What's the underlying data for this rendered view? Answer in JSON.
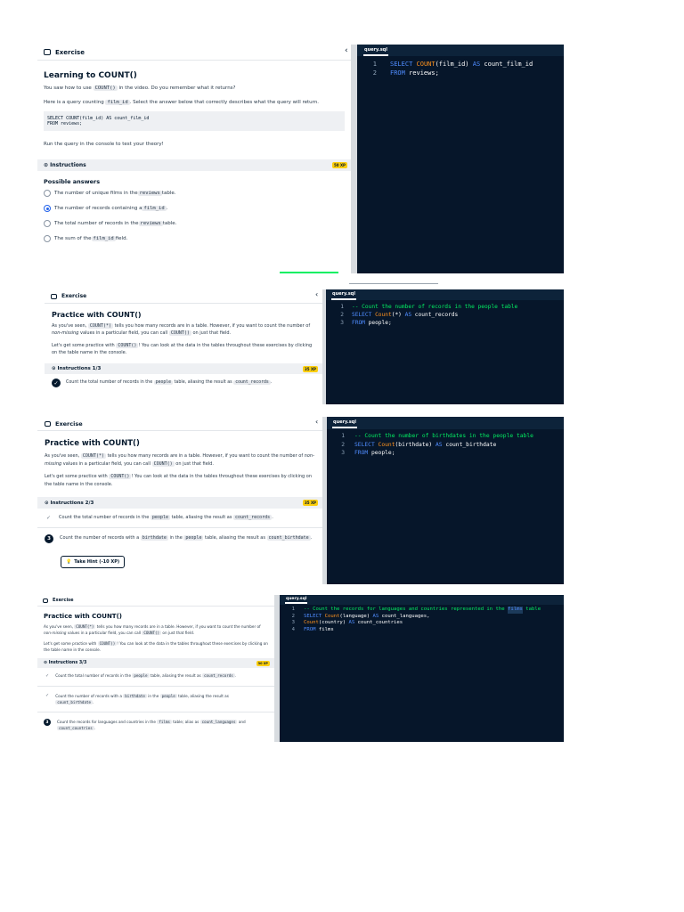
{
  "screens": {
    "s1": {
      "section_label": "Exercise",
      "title": "Learning to COUNT()",
      "p1_a": "You saw how to use ",
      "p1_code": "COUNT()",
      "p1_b": " in the video. Do you remember what it returns?",
      "p2_a": "Here is a query counting ",
      "p2_code": "film_id",
      "p2_b": ". Select the answer below that correctly describes what the query will return.",
      "code_lines": [
        "SELECT COUNT(film_id) AS count_film_id",
        "FROM reviews;"
      ],
      "p3": "Run the query in the console to test your theory!",
      "instructions_label": "Instructions",
      "xp": "50 XP",
      "possible_answers_label": "Possible answers",
      "answers": [
        {
          "a": "The number of unique films in the ",
          "code": "reviews",
          "b": " table."
        },
        {
          "a": "The number of records containing a ",
          "code": "film_id",
          "b": "."
        },
        {
          "a": "The total number of records in the ",
          "code": "reviews",
          "b": " table."
        },
        {
          "a": "The sum of the ",
          "code": "film_id",
          "b": " field."
        }
      ],
      "tab": "query.sql",
      "editor": [
        {
          "n": "1",
          "t1": "SELECT ",
          "f": "COUNT",
          "t2": "(film_id) ",
          "k2": "AS",
          "t3": " count_film_id"
        },
        {
          "n": "2",
          "t1": "FROM",
          "f": "",
          "t2": " reviews;",
          "k2": "",
          "t3": ""
        }
      ]
    },
    "s2": {
      "section_label": "Exercise",
      "title": "Practice with COUNT()",
      "p1_a": "As you've seen, ",
      "p1_code": "COUNT(*)",
      "p1_b": " tells you how many records are in a table. However, if you want to count the number of ",
      "p1_em": "non-missing",
      "p1_c": " values in a particular field, you can call ",
      "p1_code2": "COUNT()",
      "p1_d": " on just that field.",
      "p2_a": "Let's get some practice with ",
      "p2_code": "COUNT()",
      "p2_b": "! You can look at the data in the tables throughout these exercises by clicking on the table name in the console.",
      "instructions_label": "Instructions 1/3",
      "xp": "35 XP",
      "step1_a": "Count the total number of records in the ",
      "step1_code": "people",
      "step1_b": " table, aliasing the result as ",
      "step1_code2": "count_records",
      "step1_c": ".",
      "tab": "query.sql",
      "editor": [
        {
          "n": "1",
          "c": "-- Count the number of records in the people table"
        },
        {
          "n": "2",
          "k1": "SELECT ",
          "f": "Count",
          "t": "(*) ",
          "k2": "AS",
          "t2": " count_records"
        },
        {
          "n": "3",
          "k1": "FROM",
          "t": " people;"
        }
      ]
    },
    "s3": {
      "section_label": "Exercise",
      "title": "Practice with COUNT()",
      "p1_a": "As you've seen, ",
      "p1_code": "COUNT(*)",
      "p1_b": " tells you how many records are in a table. However, if you want to count the number of ",
      "p1_em": "non-missing",
      "p1_c": " values in a particular field, you can call ",
      "p1_code2": "COUNT()",
      "p1_d": " on just that field.",
      "p2_a": "Let's get some practice with ",
      "p2_code": "COUNT()",
      "p2_b": "! You can look at the data in the tables throughout these exercises by clicking on the table name in the console.",
      "instructions_label": "Instructions 2/3",
      "xp": "35 XP",
      "step1_a": "Count the total number of records in the ",
      "step1_code": "people",
      "step1_b": " table, aliasing the result as ",
      "step1_code2": "count_records",
      "step1_c": ".",
      "step2_a": "Count the number of records with a ",
      "step2_code": "birthdate",
      "step2_b": " in the ",
      "step2_code2": "people",
      "step2_c": " table, aliasing the result as ",
      "step2_code3": "count_birthdate",
      "step2_d": ".",
      "hint": "Take Hint (-10 XP)",
      "tab": "query.sql",
      "editor": [
        {
          "n": "1",
          "c": "-- Count the number of birthdates in the people table"
        },
        {
          "n": "2",
          "k1": "SELECT ",
          "f": "Count",
          "t": "(birthdate) ",
          "k2": "AS",
          "t2": " count_birthdate"
        },
        {
          "n": "3",
          "k1": "FROM",
          "t": " people;"
        }
      ]
    },
    "s4": {
      "section_label": "Exercise",
      "title": "Practice with COUNT()",
      "p1_a": "As you've seen, ",
      "p1_code": "COUNT(*)",
      "p1_b": " tells you how many records are in a table. However, if you want to count the number of ",
      "p1_em": "non-missing",
      "p1_c": " values in a particular field, you can call ",
      "p1_code2": "COUNT()",
      "p1_d": " on just that field.",
      "p2_a": "Let's get some practice with ",
      "p2_code": "COUNT()",
      "p2_b": "! You can look at the data in the tables throughout these exercises by clicking on the table name in the console.",
      "instructions_label": "Instructions 3/3",
      "xp": "30 XP",
      "step1_a": "Count the total number of records in the ",
      "step1_code": "people",
      "step1_b": " table, aliasing the result as ",
      "step1_code2": "count_records",
      "step1_c": ".",
      "step2_a": "Count the number of records with a ",
      "step2_code": "birthdate",
      "step2_b": " in the ",
      "step2_code2": "people",
      "step2_c": " table, aliasing the result as ",
      "step2_code3": "count_birthdate",
      "step2_d": ".",
      "step3_a": "Count the records for languages and countries in the ",
      "step3_code": "films",
      "step3_b": " table; alias as ",
      "step3_code2": "count_languages",
      "step3_c": " and ",
      "step3_code3": "count_countries",
      "step3_d": ".",
      "tab": "query.sql",
      "editor": [
        {
          "n": "1",
          "c": "-- Count the records for languages and countries represented in the ",
          "h": "films",
          "c2": " table"
        },
        {
          "n": "2",
          "k1": "SELECT ",
          "f": "Count",
          "t": "(language) ",
          "k2": "AS",
          "t2": " count_languages,"
        },
        {
          "n": "3",
          "f": "Count",
          "t": "(country) ",
          "k2": "AS",
          "t2": " count_countries"
        },
        {
          "n": "4",
          "k1": "FROM",
          "t": " films"
        }
      ]
    }
  }
}
